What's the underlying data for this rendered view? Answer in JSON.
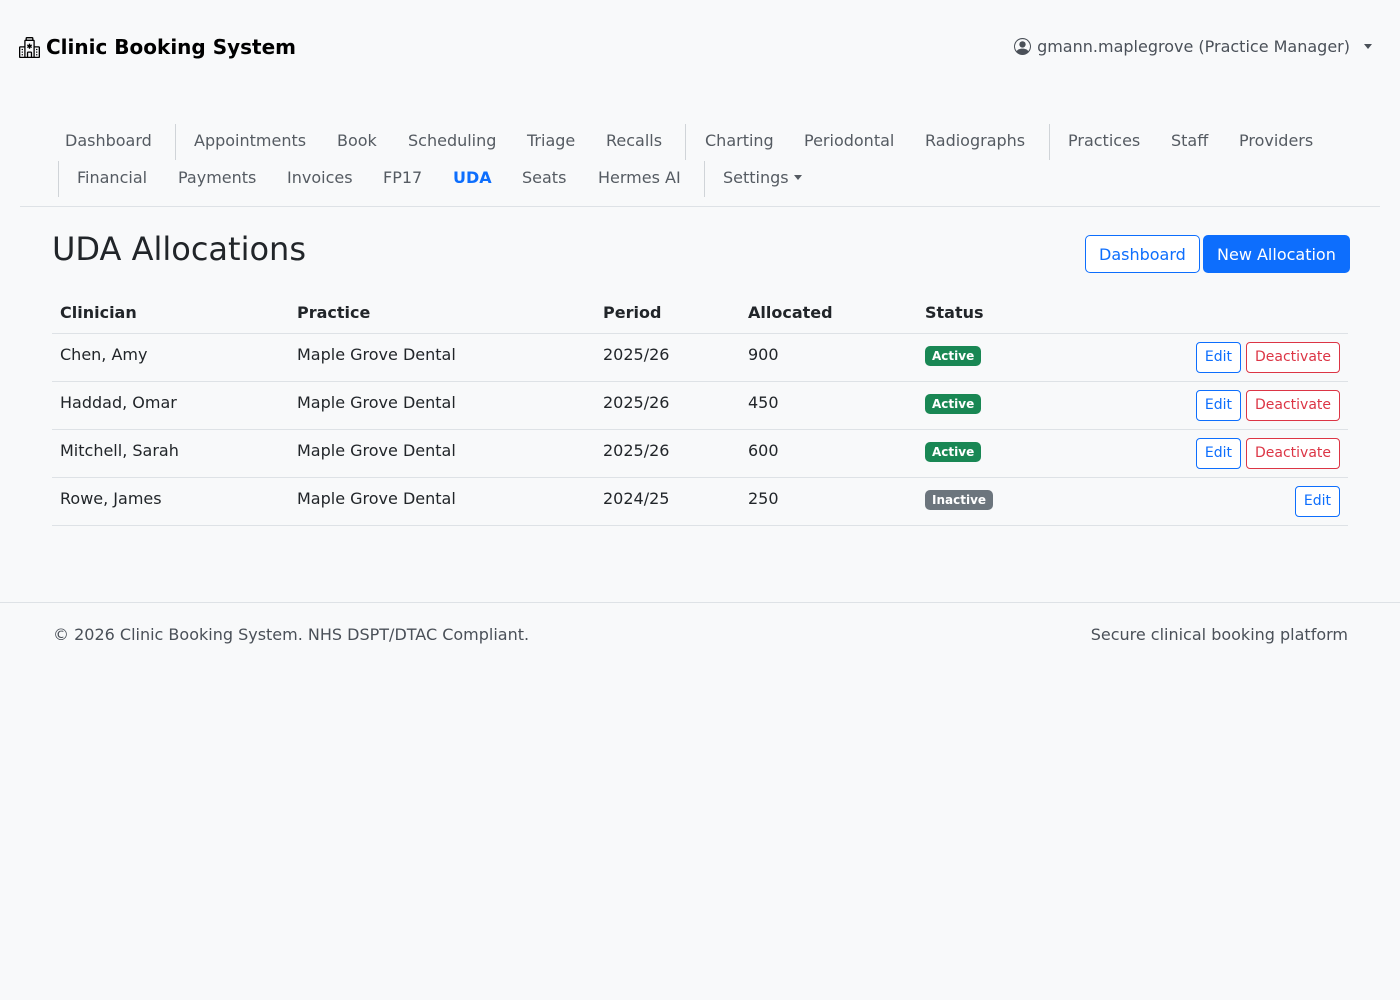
{
  "app": {
    "title": "Clinic Booking System",
    "brand_icon": "hospital-icon"
  },
  "user_menu": {
    "label": "gmann.maplegrove (Practice Manager)",
    "icon": "user-circle-icon"
  },
  "nav": {
    "row1": [
      {
        "label": "Dashboard",
        "active": false
      },
      {
        "label": "Appointments",
        "active": false
      },
      {
        "label": "Book",
        "active": false
      },
      {
        "label": "Scheduling",
        "active": false
      },
      {
        "label": "Triage",
        "active": false
      },
      {
        "label": "Recalls",
        "active": false
      },
      {
        "label": "Charting",
        "active": false
      },
      {
        "label": "Periodontal",
        "active": false
      },
      {
        "label": "Radiographs",
        "active": false
      },
      {
        "label": "Practices",
        "active": false
      },
      {
        "label": "Staff",
        "active": false
      },
      {
        "label": "Providers",
        "active": false
      }
    ],
    "row2": [
      {
        "label": "Financial",
        "active": false
      },
      {
        "label": "Payments",
        "active": false
      },
      {
        "label": "Invoices",
        "active": false
      },
      {
        "label": "FP17",
        "active": false
      },
      {
        "label": "UDA",
        "active": true
      },
      {
        "label": "Seats",
        "active": false
      },
      {
        "label": "Hermes AI",
        "active": false
      },
      {
        "label": "Settings",
        "active": false,
        "dropdown": true
      }
    ]
  },
  "page": {
    "title": "UDA Allocations",
    "dashboard_button": "Dashboard",
    "new_button": "New Allocation"
  },
  "table": {
    "headers": [
      "Clinician",
      "Practice",
      "Period",
      "Allocated",
      "Status",
      ""
    ],
    "rows": [
      {
        "clinician": "Chen, Amy",
        "practice": "Maple Grove Dental",
        "period": "2025/26",
        "allocated": "900",
        "status": "Active",
        "edit": "Edit",
        "deactivate": "Deactivate"
      },
      {
        "clinician": "Haddad, Omar",
        "practice": "Maple Grove Dental",
        "period": "2025/26",
        "allocated": "450",
        "status": "Active",
        "edit": "Edit",
        "deactivate": "Deactivate"
      },
      {
        "clinician": "Mitchell, Sarah",
        "practice": "Maple Grove Dental",
        "period": "2025/26",
        "allocated": "600",
        "status": "Active",
        "edit": "Edit",
        "deactivate": "Deactivate"
      },
      {
        "clinician": "Rowe, James",
        "practice": "Maple Grove Dental",
        "period": "2024/25",
        "allocated": "250",
        "status": "Inactive",
        "edit": "Edit",
        "deactivate": null
      }
    ]
  },
  "footer": {
    "left": "© 2026 Clinic Booking System. NHS DSPT/DTAC Compliant.",
    "right": "Secure clinical booking platform"
  },
  "colors": {
    "primary": "#0d6efd",
    "danger": "#dc3545",
    "success": "#198754",
    "secondary": "#6c757d",
    "background": "#f8f9fa"
  }
}
